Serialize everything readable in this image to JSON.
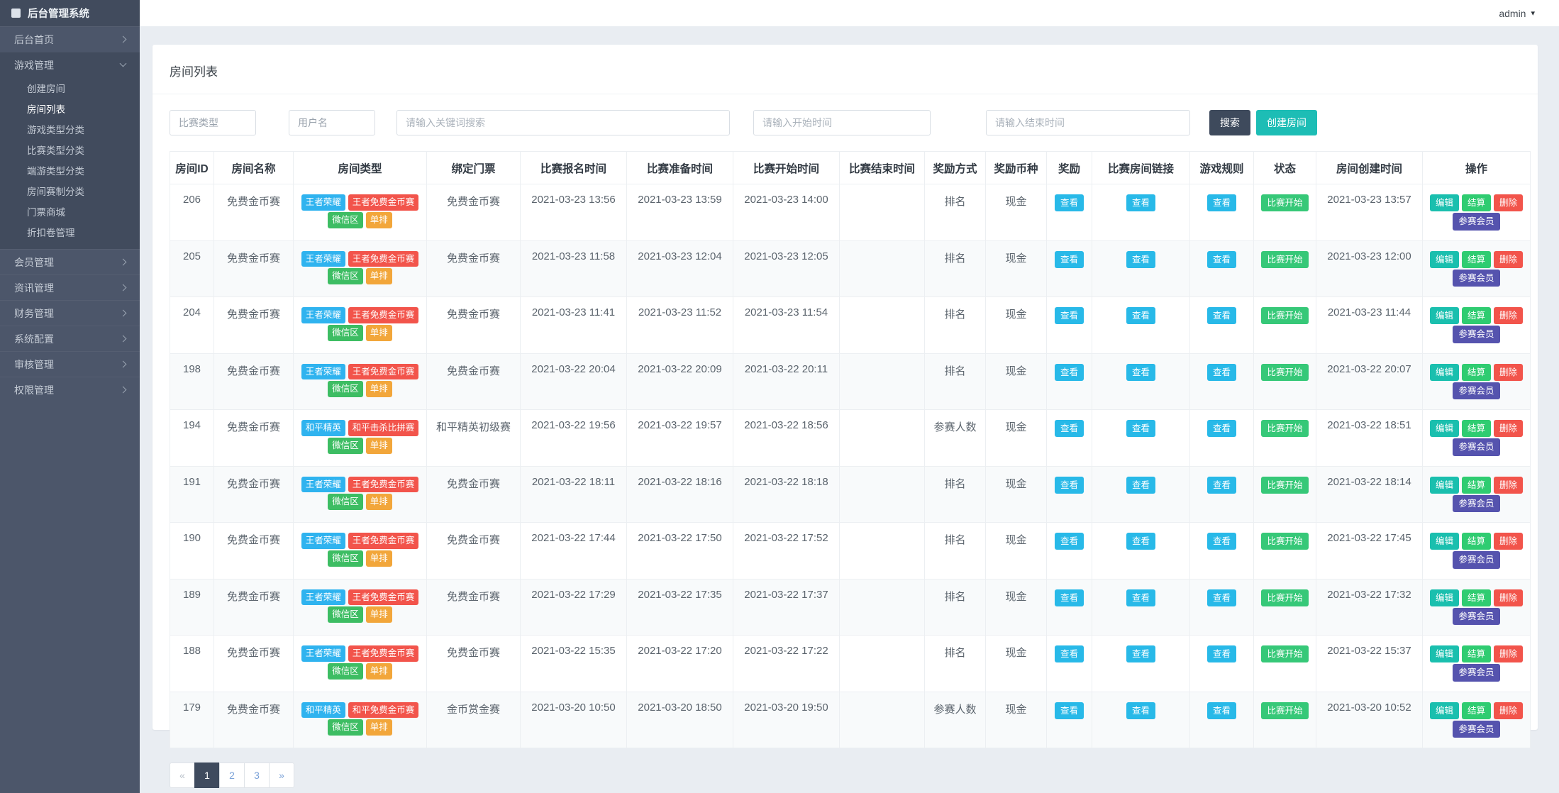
{
  "header": {
    "user": "admin"
  },
  "sidebar": {
    "brand": "后台管理系统",
    "items": [
      {
        "label": "后台首页",
        "expanded": false
      },
      {
        "label": "游戏管理",
        "expanded": true,
        "children": [
          "创建房间",
          "房间列表",
          "游戏类型分类",
          "比赛类型分类",
          "端游类型分类",
          "房间赛制分类",
          "门票商城",
          "折扣卷管理"
        ],
        "active_child": "房间列表"
      },
      {
        "label": "会员管理",
        "expanded": false
      },
      {
        "label": "资讯管理",
        "expanded": false
      },
      {
        "label": "财务管理",
        "expanded": false
      },
      {
        "label": "系统配置",
        "expanded": false
      },
      {
        "label": "审核管理",
        "expanded": false
      },
      {
        "label": "权限管理",
        "expanded": false
      }
    ]
  },
  "page": {
    "title": "房间列表"
  },
  "filters": {
    "match_type_select": "比赛类型",
    "username_select": "用户名",
    "keyword_placeholder": "请输入关键词搜索",
    "start_time_placeholder": "请输入开始时间",
    "end_time_placeholder": "请输入结束时间",
    "search_button": "搜索",
    "create_button": "创建房间"
  },
  "table": {
    "columns": [
      "房间ID",
      "房间名称",
      "房间类型",
      "绑定门票",
      "比赛报名时间",
      "比赛准备时间",
      "比赛开始时间",
      "比赛结束时间",
      "奖励方式",
      "奖励币种",
      "奖励",
      "比赛房间链接",
      "游戏规则",
      "状态",
      "房间创建时间",
      "操作"
    ],
    "view_label": "查看",
    "status_label": "比赛开始",
    "actions": [
      "编辑",
      "结算",
      "删除",
      "参赛会员"
    ],
    "rows": [
      {
        "id": "206",
        "name": "免费金币赛",
        "tags": [
          {
            "text": "王者荣耀",
            "color": "blue"
          },
          {
            "text": "王者免费金币赛",
            "color": "red"
          },
          {
            "text": "微信区",
            "color": "green"
          },
          {
            "text": "单排",
            "color": "orange"
          }
        ],
        "ticket": "免费金币赛",
        "signup": "2021-03-23 13:56",
        "ready": "2021-03-23 13:59",
        "start": "2021-03-23 14:00",
        "end": "",
        "reward_mode": "排名",
        "currency": "现金",
        "created": "2021-03-23 13:57"
      },
      {
        "id": "205",
        "name": "免费金币赛",
        "tags": [
          {
            "text": "王者荣耀",
            "color": "blue"
          },
          {
            "text": "王者免费金币赛",
            "color": "red"
          },
          {
            "text": "微信区",
            "color": "green"
          },
          {
            "text": "单排",
            "color": "orange"
          }
        ],
        "ticket": "免费金币赛",
        "signup": "2021-03-23 11:58",
        "ready": "2021-03-23 12:04",
        "start": "2021-03-23 12:05",
        "end": "",
        "reward_mode": "排名",
        "currency": "现金",
        "created": "2021-03-23 12:00"
      },
      {
        "id": "204",
        "name": "免费金币赛",
        "tags": [
          {
            "text": "王者荣耀",
            "color": "blue"
          },
          {
            "text": "王者免费金币赛",
            "color": "red"
          },
          {
            "text": "微信区",
            "color": "green"
          },
          {
            "text": "单排",
            "color": "orange"
          }
        ],
        "ticket": "免费金币赛",
        "signup": "2021-03-23 11:41",
        "ready": "2021-03-23 11:52",
        "start": "2021-03-23 11:54",
        "end": "",
        "reward_mode": "排名",
        "currency": "现金",
        "created": "2021-03-23 11:44"
      },
      {
        "id": "198",
        "name": "免费金币赛",
        "tags": [
          {
            "text": "王者荣耀",
            "color": "blue"
          },
          {
            "text": "王者免费金币赛",
            "color": "red"
          },
          {
            "text": "微信区",
            "color": "green"
          },
          {
            "text": "单排",
            "color": "orange"
          }
        ],
        "ticket": "免费金币赛",
        "signup": "2021-03-22 20:04",
        "ready": "2021-03-22 20:09",
        "start": "2021-03-22 20:11",
        "end": "",
        "reward_mode": "排名",
        "currency": "现金",
        "created": "2021-03-22 20:07"
      },
      {
        "id": "194",
        "name": "免费金币赛",
        "tags": [
          {
            "text": "和平精英",
            "color": "blue"
          },
          {
            "text": "和平击杀比拼赛",
            "color": "red"
          },
          {
            "text": "微信区",
            "color": "green"
          },
          {
            "text": "单排",
            "color": "orange"
          }
        ],
        "ticket": "和平精英初级赛",
        "signup": "2021-03-22 19:56",
        "ready": "2021-03-22 19:57",
        "start": "2021-03-22 18:56",
        "end": "",
        "reward_mode": "参赛人数",
        "currency": "现金",
        "created": "2021-03-22 18:51"
      },
      {
        "id": "191",
        "name": "免费金币赛",
        "tags": [
          {
            "text": "王者荣耀",
            "color": "blue"
          },
          {
            "text": "王者免费金币赛",
            "color": "red"
          },
          {
            "text": "微信区",
            "color": "green"
          },
          {
            "text": "单排",
            "color": "orange"
          }
        ],
        "ticket": "免费金币赛",
        "signup": "2021-03-22 18:11",
        "ready": "2021-03-22 18:16",
        "start": "2021-03-22 18:18",
        "end": "",
        "reward_mode": "排名",
        "currency": "现金",
        "created": "2021-03-22 18:14"
      },
      {
        "id": "190",
        "name": "免费金币赛",
        "tags": [
          {
            "text": "王者荣耀",
            "color": "blue"
          },
          {
            "text": "王者免费金币赛",
            "color": "red"
          },
          {
            "text": "微信区",
            "color": "green"
          },
          {
            "text": "单排",
            "color": "orange"
          }
        ],
        "ticket": "免费金币赛",
        "signup": "2021-03-22 17:44",
        "ready": "2021-03-22 17:50",
        "start": "2021-03-22 17:52",
        "end": "",
        "reward_mode": "排名",
        "currency": "现金",
        "created": "2021-03-22 17:45"
      },
      {
        "id": "189",
        "name": "免费金币赛",
        "tags": [
          {
            "text": "王者荣耀",
            "color": "blue"
          },
          {
            "text": "王者免费金币赛",
            "color": "red"
          },
          {
            "text": "微信区",
            "color": "green"
          },
          {
            "text": "单排",
            "color": "orange"
          }
        ],
        "ticket": "免费金币赛",
        "signup": "2021-03-22 17:29",
        "ready": "2021-03-22 17:35",
        "start": "2021-03-22 17:37",
        "end": "",
        "reward_mode": "排名",
        "currency": "现金",
        "created": "2021-03-22 17:32"
      },
      {
        "id": "188",
        "name": "免费金币赛",
        "tags": [
          {
            "text": "王者荣耀",
            "color": "blue"
          },
          {
            "text": "王者免费金币赛",
            "color": "red"
          },
          {
            "text": "微信区",
            "color": "green"
          },
          {
            "text": "单排",
            "color": "orange"
          }
        ],
        "ticket": "免费金币赛",
        "signup": "2021-03-22 15:35",
        "ready": "2021-03-22 17:20",
        "start": "2021-03-22 17:22",
        "end": "",
        "reward_mode": "排名",
        "currency": "现金",
        "created": "2021-03-22 15:37"
      },
      {
        "id": "179",
        "name": "免费金币赛",
        "tags": [
          {
            "text": "和平精英",
            "color": "blue"
          },
          {
            "text": "和平免费金币赛",
            "color": "red"
          },
          {
            "text": "微信区",
            "color": "green"
          },
          {
            "text": "单排",
            "color": "orange"
          }
        ],
        "ticket": "金币赏金赛",
        "signup": "2021-03-20 10:50",
        "ready": "2021-03-20 18:50",
        "start": "2021-03-20 19:50",
        "end": "",
        "reward_mode": "参赛人数",
        "currency": "现金",
        "created": "2021-03-20 10:52"
      }
    ]
  },
  "pagination": {
    "items": [
      "«",
      "1",
      "2",
      "3",
      "»"
    ],
    "active": "1"
  },
  "colors": {
    "tag_blue": "#2fb3ef",
    "tag_red": "#f2544b",
    "tag_green": "#3dbd63",
    "tag_orange": "#f2a63a",
    "view_button": "#28b9e8",
    "status_button": "#36c878",
    "edit_button": "#1abfae",
    "settle_button": "#2fcc71",
    "delete_button": "#f2544b",
    "member_button": "#5553ae",
    "search_button": "#3e4a5c",
    "create_button": "#1dbdb5",
    "sidebar_bg": "#4c566a",
    "sidebar_dark": "#414b5d",
    "pagination_active": "#3f4b5e"
  }
}
